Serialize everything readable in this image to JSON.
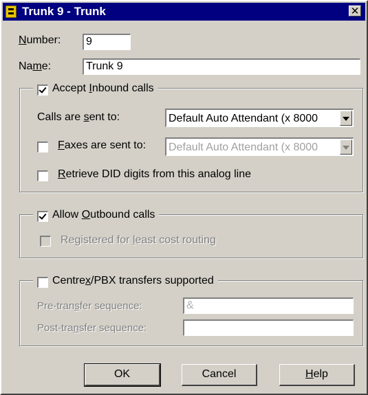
{
  "window": {
    "title": "Trunk 9 - Trunk",
    "close_glyph": "✕"
  },
  "number": {
    "label_pre": "",
    "label_ul": "N",
    "label_post": "umber:",
    "value": "9"
  },
  "name": {
    "label_pre": "Na",
    "label_ul": "m",
    "label_post": "e:",
    "value": "Trunk 9"
  },
  "inbound": {
    "checkbox_checked": true,
    "title_pre": "Accept ",
    "title_ul": "I",
    "title_post": "nbound calls",
    "calls_sent_pre": "Calls are ",
    "calls_sent_ul": "s",
    "calls_sent_post": "ent to:",
    "calls_sent_value": "Default Auto Attendant (x 8000",
    "faxes_checked": false,
    "faxes_pre": "",
    "faxes_ul": "F",
    "faxes_post": "axes are sent to:",
    "faxes_value": "Default Auto Attendant (x 8000",
    "did_checked": false,
    "did_pre": "",
    "did_ul": "R",
    "did_post": "etrieve DID digits from this analog line"
  },
  "outbound": {
    "checkbox_checked": true,
    "title_pre": "Allow ",
    "title_ul": "O",
    "title_post": "utbound calls",
    "lcr_checked": false,
    "lcr_pre": "Registered for ",
    "lcr_ul": "l",
    "lcr_post": "east cost routing"
  },
  "centrex": {
    "checkbox_checked": false,
    "title_pre": "Centre",
    "title_ul": "x",
    "title_post": "/PBX transfers supported",
    "pre_label_pre": "Pre-tran",
    "pre_label_ul": "s",
    "pre_label_post": "fer sequence:",
    "pre_value": "&",
    "post_label_pre": "Post-tra",
    "post_label_ul": "n",
    "post_label_post": "sfer sequence:",
    "post_value": ""
  },
  "buttons": {
    "ok": "OK",
    "cancel": "Cancel",
    "help_pre": "",
    "help_ul": "H",
    "help_post": "elp"
  }
}
